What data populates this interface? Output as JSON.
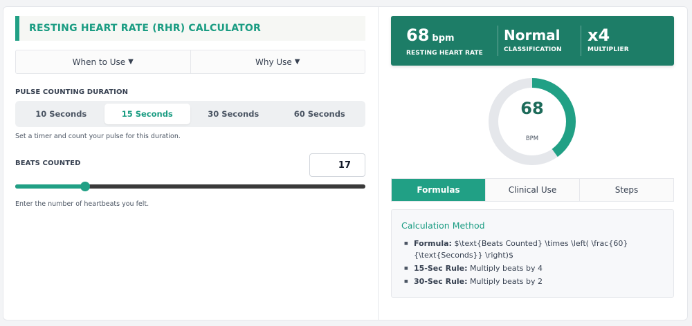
{
  "calculator": {
    "title": "RESTING HEART RATE (RHR) CALCULATOR",
    "info_buttons": [
      {
        "label": "When to Use",
        "caret": "▼"
      },
      {
        "label": "Why Use",
        "caret": "▼"
      }
    ],
    "duration": {
      "label": "PULSE COUNTING DURATION",
      "options": [
        "10 Seconds",
        "15 Seconds",
        "30 Seconds",
        "60 Seconds"
      ],
      "selected": "15 Seconds",
      "help": "Set a timer and count your pulse for this duration."
    },
    "beats": {
      "label": "BEATS COUNTED",
      "value": "17",
      "slider_fraction": 0.2,
      "help": "Enter the number of heartbeats you felt."
    }
  },
  "result": {
    "rate": "68",
    "rate_unit": "bpm",
    "rate_caption": "RESTING HEART RATE",
    "classification": "Normal",
    "classification_caption": "CLASSIFICATION",
    "multiplier": "x4",
    "multiplier_caption": "MULTIPLIER",
    "gauge_value": "68",
    "gauge_unit": "BPM",
    "gauge_fraction": 0.4
  },
  "tabs": [
    "Formulas",
    "Clinical Use",
    "Steps"
  ],
  "active_tab": "Formulas",
  "formulas": {
    "heading": "Calculation Method",
    "items": [
      {
        "term": "Formula:",
        "text": "$\\text{Beats Counted} \\times \\left( \\frac{60}{\\text{Seconds}} \\right)$"
      },
      {
        "term": "15-Sec Rule:",
        "text": "Multiply beats by 4"
      },
      {
        "term": "30-Sec Rule:",
        "text": "Multiply beats by 2"
      }
    ]
  },
  "colors": {
    "accent": "#21a085",
    "banner": "#1d7d67",
    "gauge_track": "#e5e7eb"
  }
}
